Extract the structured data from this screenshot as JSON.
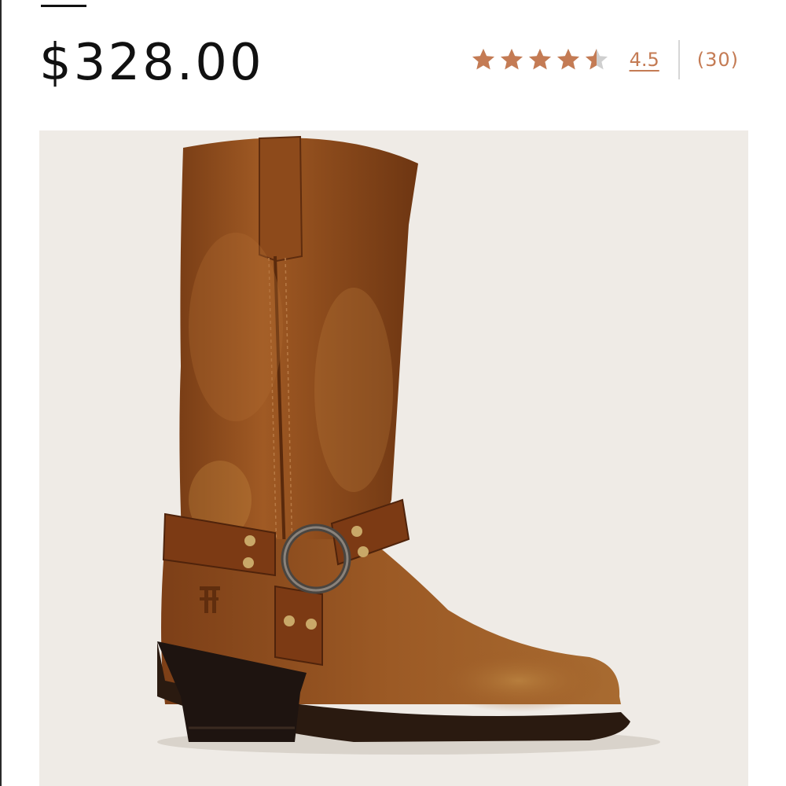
{
  "product": {
    "price": "$328.00",
    "image_alt": "brown leather harness boot"
  },
  "rating": {
    "stars_value": 4.5,
    "stars_max": 5,
    "value_label": "4.5",
    "review_count_label": "(30)"
  },
  "colors": {
    "accent": "#c47b54",
    "star_empty": "#cfcfcf",
    "image_background": "#efebe6",
    "leather": "#8a4a1e"
  },
  "icons": {
    "star": "star-icon",
    "logo": "brand-monogram-icon"
  }
}
